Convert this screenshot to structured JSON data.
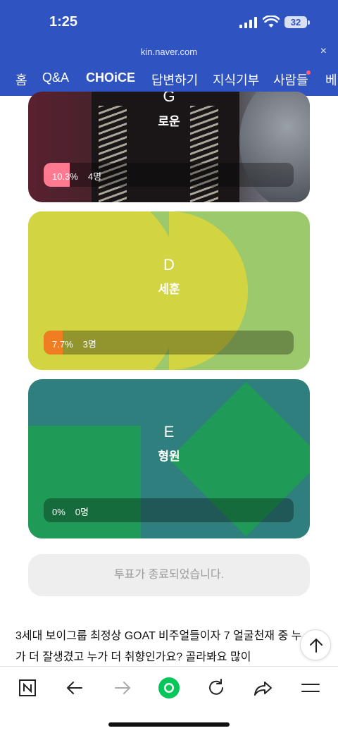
{
  "status_bar": {
    "time": "1:25",
    "battery": "32"
  },
  "browser": {
    "url": "kin.naver.com",
    "close_glyph": "×"
  },
  "nav_tabs": [
    {
      "label": "홈"
    },
    {
      "label": "Q&A"
    },
    {
      "label": "CHOiCE",
      "active": true
    },
    {
      "label": "답변하기"
    },
    {
      "label": "지식기부"
    },
    {
      "label": "사람들",
      "has_new_dot": true
    },
    {
      "label": "베"
    }
  ],
  "candidates": [
    {
      "letter": "G",
      "name": "로운",
      "percent_label": "10.3%",
      "votes_label": "4명",
      "percent": 10.3,
      "fill_color": "#ff7a90"
    },
    {
      "letter": "D",
      "name": "세훈",
      "percent_label": "7.7%",
      "votes_label": "3명",
      "percent": 7.7,
      "fill_color": "#f07d22"
    },
    {
      "letter": "E",
      "name": "형원",
      "percent_label": "0%",
      "votes_label": "0명",
      "percent": 0,
      "fill_color": "#f07d22"
    }
  ],
  "vote_status": "투표가 종료되었습니다.",
  "question": "3세대 보이그룹 최정상 GOAT 비주얼들이자 7 얼굴천재 중 누가 더 잘생겼고 누가 더 취향인가요? 골라봐요 많이",
  "toolbar_icons": [
    "naver-n-icon",
    "back-arrow-icon",
    "forward-arrow-icon",
    "green-dot-home-icon",
    "refresh-icon",
    "share-icon",
    "menu-icon"
  ],
  "colors": {
    "brand_blue": "#2f53c0",
    "naver_green": "#03c75a"
  }
}
